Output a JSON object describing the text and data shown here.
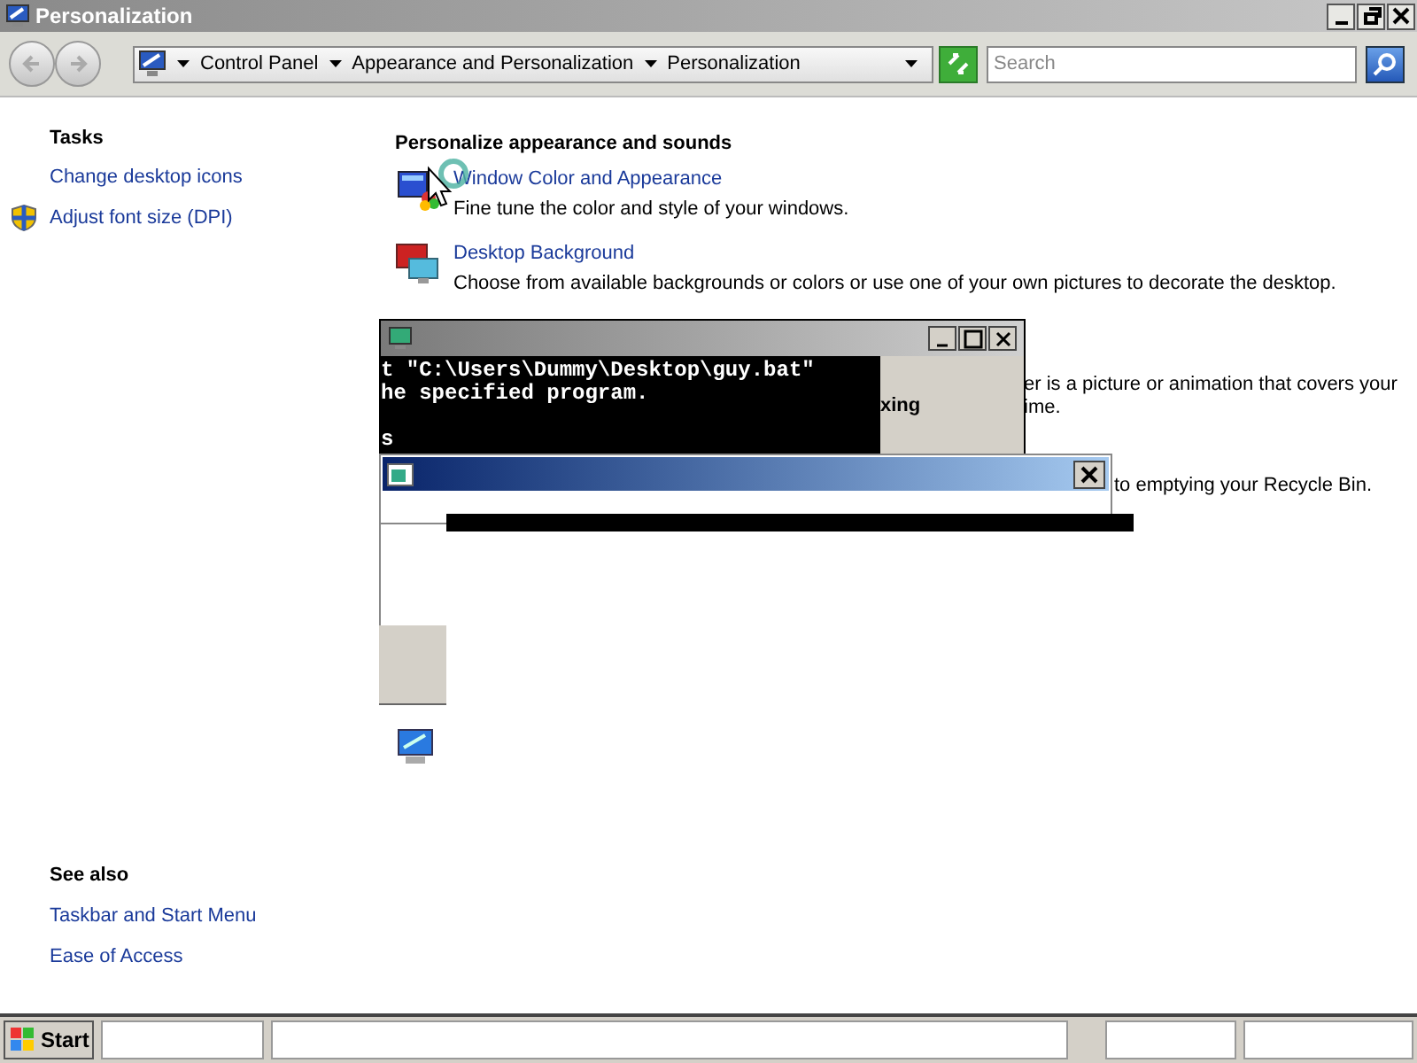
{
  "window": {
    "title": "Personalization"
  },
  "address_bar": {
    "breadcrumbs": [
      "Control Panel",
      "Appearance and Personalization",
      "Personalization"
    ]
  },
  "search": {
    "placeholder": "Search"
  },
  "sidebar": {
    "tasks_heading": "Tasks",
    "tasks": [
      {
        "label": "Change desktop icons",
        "kind": "plain"
      },
      {
        "label": "Adjust font size (DPI)",
        "kind": "shield"
      }
    ],
    "see_also_heading": "See also",
    "see_also": [
      "Taskbar and Start Menu",
      "Ease of Access"
    ]
  },
  "main": {
    "heading": "Personalize appearance and sounds",
    "items": [
      {
        "kind": "window-color",
        "title": "Window Color and Appearance",
        "description": "Fine tune the color and style of your windows."
      },
      {
        "kind": "desktop-background",
        "title": "Desktop Background",
        "description": "Choose from available backgrounds or colors or use one of your own pictures to decorate the desktop."
      }
    ]
  },
  "obscured_fragments": [
    {
      "text": "er is a picture or animation that covers your",
      "bold": false
    },
    {
      "text": "ime.",
      "bold": false
    },
    {
      "text": "to emptying your Recycle Bin.",
      "bold": false
    }
  ],
  "console_window": {
    "paragraphs": [
      [
        "t \"C:\\Users\\Dummy\\Desktop\\guy.bat\"",
        "he specified program."
      ],
      [
        "s"
      ]
    ],
    "side_text": "xing"
  },
  "taskbar": {
    "start": "Start"
  }
}
